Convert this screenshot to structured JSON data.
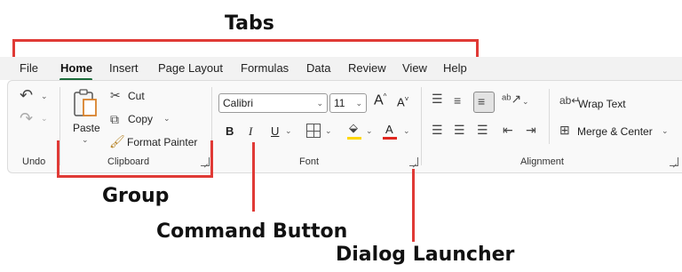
{
  "annotations": {
    "tabs": "Tabs",
    "group": "Group",
    "command_button": "Command Button",
    "dialog_launcher": "Dialog Launcher"
  },
  "tabs": [
    "File",
    "Home",
    "Insert",
    "Page Layout",
    "Formulas",
    "Data",
    "Review",
    "View",
    "Help"
  ],
  "active_tab": "Home",
  "groups": {
    "undo": "Undo",
    "clipboard": "Clipboard",
    "font": "Font",
    "alignment": "Alignment"
  },
  "clipboard": {
    "paste": "Paste",
    "cut": "Cut",
    "copy": "Copy",
    "format_painter": "Format Painter"
  },
  "font": {
    "name": "Calibri",
    "size": "11",
    "bold": "B",
    "italic": "I",
    "underline": "U",
    "grow": "A",
    "shrink": "A",
    "font_color": "A"
  },
  "alignment": {
    "wrap_text": "Wrap Text",
    "merge_center": "Merge & Center"
  },
  "colors": {
    "annotation_red": "#e03a36",
    "accent_green": "#1a6b3a",
    "highlight_yellow": "#ffd700",
    "font_color_red": "#e0271f"
  }
}
